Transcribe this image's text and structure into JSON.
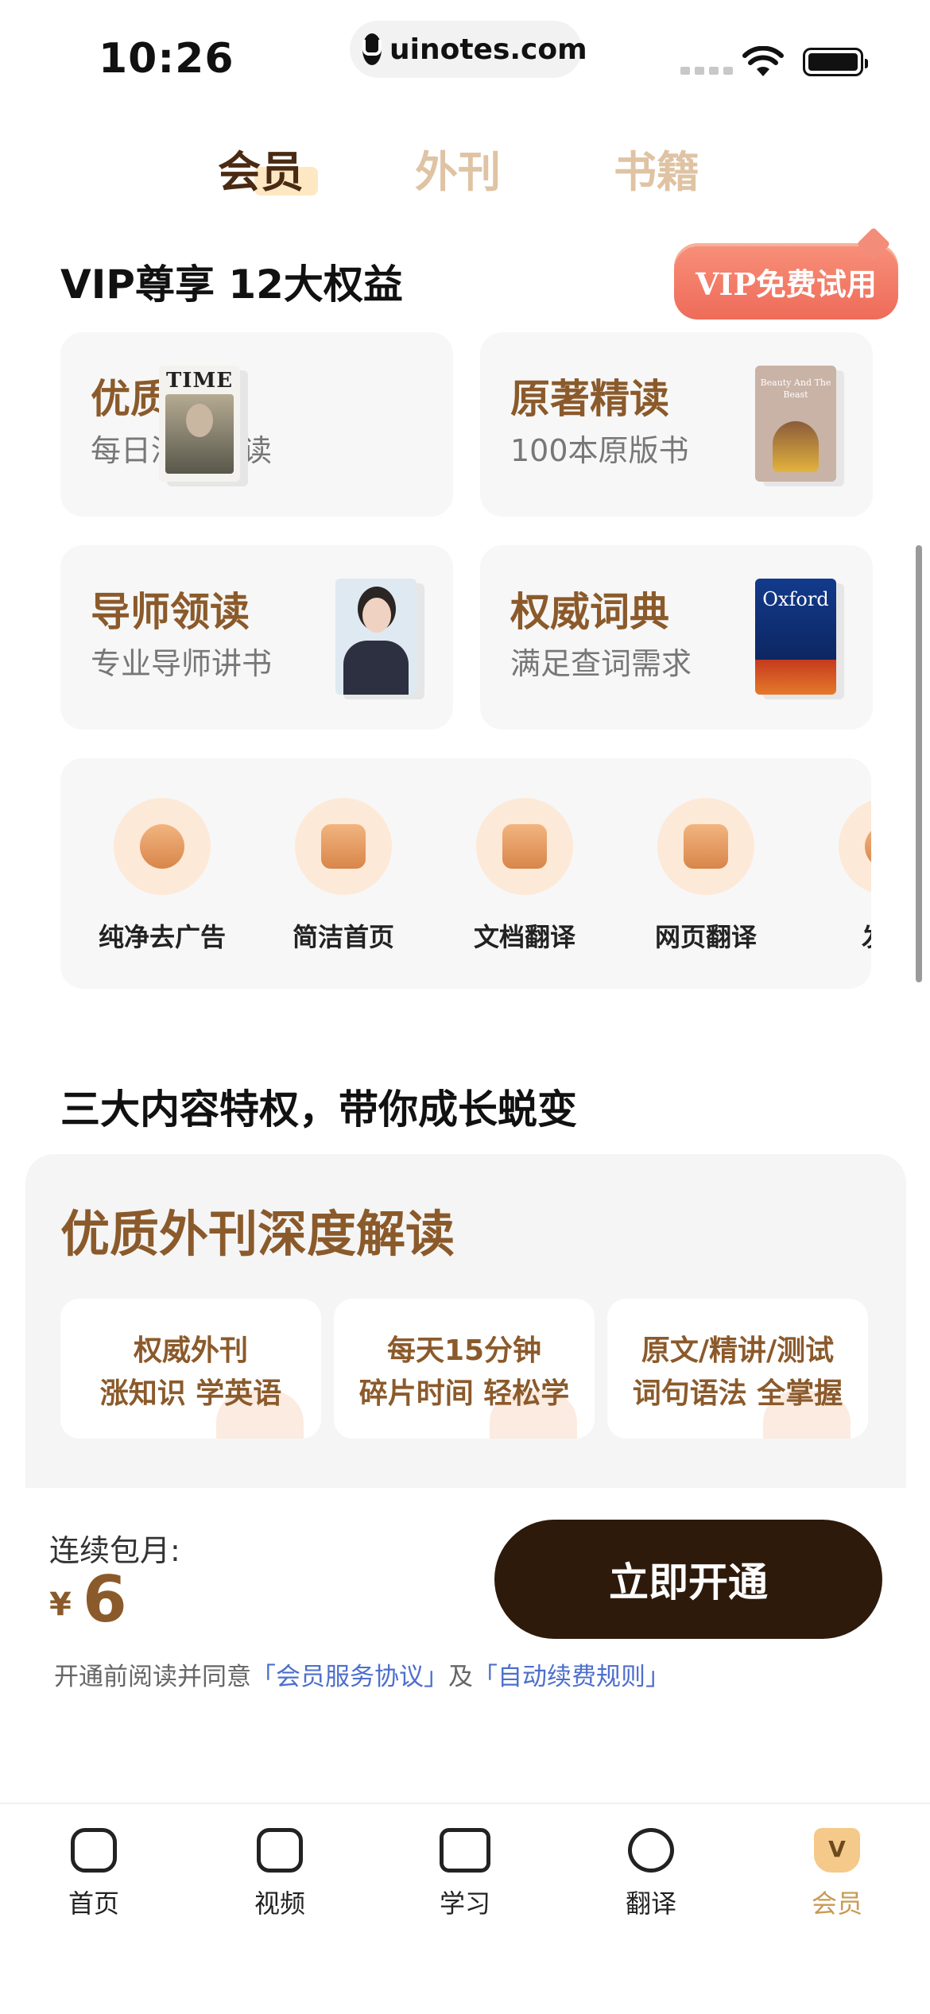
{
  "status": {
    "time": "10:26",
    "url": "uinotes.com"
  },
  "tabs": [
    {
      "label": "会员",
      "active": true
    },
    {
      "label": "外刊",
      "active": false
    },
    {
      "label": "书籍",
      "active": false
    }
  ],
  "benefits": {
    "title": "VIP尊享 12大权益",
    "trial_badge": "VIP免费试用",
    "cards": [
      {
        "title": "优质外刊",
        "subtitle": "每日深度解读",
        "thumb_text": "TIME"
      },
      {
        "title": "原著精读",
        "subtitle": "100本原版书",
        "thumb_text": "Beauty And The Beast"
      },
      {
        "title": "导师领读",
        "subtitle": "专业导师讲书"
      },
      {
        "title": "权威词典",
        "subtitle": "满足查词需求",
        "thumb_text": "Oxford"
      }
    ],
    "features": [
      {
        "label": "纯净去广告",
        "icon": "ad-block-icon"
      },
      {
        "label": "简洁首页",
        "icon": "home-clean-icon"
      },
      {
        "label": "文档翻译",
        "icon": "document-translate-icon"
      },
      {
        "label": "网页翻译",
        "icon": "web-translate-icon"
      },
      {
        "label": "发音",
        "icon": "pronunciation-icon"
      }
    ]
  },
  "content_privileges": {
    "title": "三大内容特权，带你成长蜕变",
    "panel_title": "优质外刊深度解读",
    "items": [
      {
        "line1": "权威外刊",
        "line2": "涨知识 学英语"
      },
      {
        "line1": "每天15分钟",
        "line2": "碎片时间 轻松学"
      },
      {
        "line1": "原文/精讲/测试",
        "line2": "词句语法 全掌握"
      }
    ]
  },
  "purchase": {
    "renew_label": "连续包月:",
    "currency": "¥",
    "price": "6",
    "button": "立即开通",
    "agree_prefix": "开通前阅读并同意",
    "agree_link1": "「会员服务协议」",
    "agree_mid": "及",
    "agree_link2": "「自动续费规则」"
  },
  "nav": [
    {
      "label": "首页",
      "icon": "home-search-icon"
    },
    {
      "label": "视频",
      "icon": "video-icon"
    },
    {
      "label": "学习",
      "icon": "study-icon"
    },
    {
      "label": "翻译",
      "icon": "translate-icon"
    },
    {
      "label": "会员",
      "icon": "vip-crown-icon",
      "active": true
    }
  ],
  "colors": {
    "accent": "#8b5a2b",
    "button": "#2d1a0b",
    "badge": "#ee6b59",
    "link": "#4d6fcc"
  }
}
